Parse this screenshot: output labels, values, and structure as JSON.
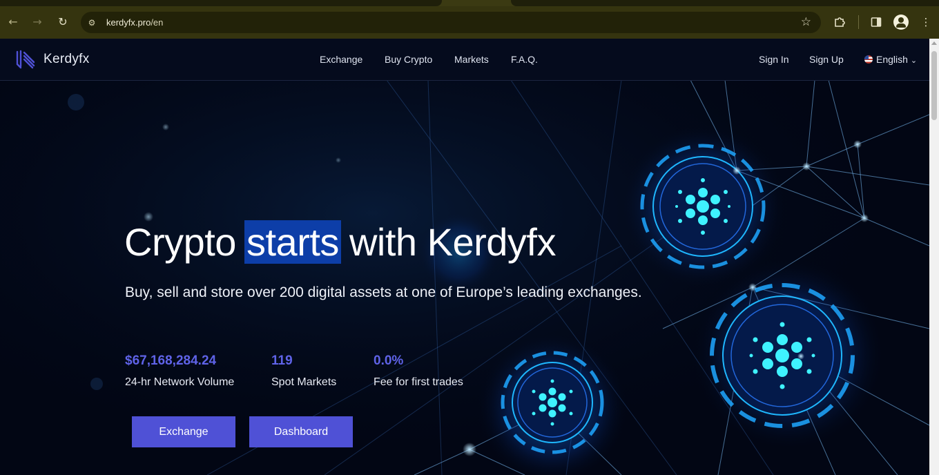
{
  "browser": {
    "url_host": "kerdyfx.pro",
    "url_path": "/en",
    "icons": {
      "back": "arrow-left-icon",
      "forward": "arrow-right-icon",
      "reload": "reload-icon",
      "site_info": "tune-icon",
      "bookmark": "star-icon",
      "extensions": "puzzle-icon",
      "side_panel": "side-panel-icon",
      "profile": "profile-icon",
      "menu": "kebab-menu-icon"
    }
  },
  "header": {
    "brand": "Kerdyfx",
    "nav": [
      "Exchange",
      "Buy Crypto",
      "Markets",
      "F.A.Q."
    ],
    "sign_in": "Sign In",
    "sign_up": "Sign Up",
    "language": "English"
  },
  "hero": {
    "headline_before": "Crypto ",
    "headline_highlight": "starts",
    "headline_after": " with Kerdyfx",
    "subheadline": "Buy, sell and store over 200 digital assets at one of Europe’s leading exchanges.",
    "stats": [
      {
        "value": "$67,168,284.24",
        "label": "24-hr Network Volume"
      },
      {
        "value": "119",
        "label": "Spot Markets"
      },
      {
        "value": "0.0%",
        "label": "Fee for first trades"
      }
    ],
    "buttons": [
      "Exchange",
      "Dashboard"
    ]
  },
  "colors": {
    "accent": "#4f51d6",
    "stat_value": "#5f63e8",
    "text_highlight": "#0d3ea8",
    "background": "#020614"
  }
}
